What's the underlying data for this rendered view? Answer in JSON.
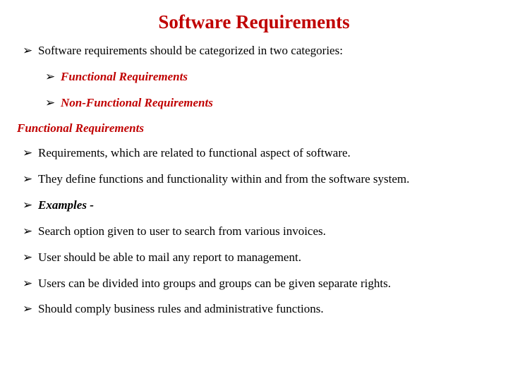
{
  "title": "Software Requirements",
  "intro": "Software requirements should be categorized in two categories:",
  "subs": {
    "a": "Functional Requirements",
    "b": "Non-Functional Requirements"
  },
  "section": "Functional Requirements",
  "bullets": {
    "b1": "Requirements, which are related to functional aspect of software.",
    "b2": "They define functions and functionality within and from the software system.",
    "b3": "Examples -",
    "b4": "Search option given to user to search from various invoices.",
    "b5": "User should be able to mail any report to management.",
    "b6": "Users can be divided into groups and groups can be given separate rights.",
    "b7": "Should comply business rules and administrative functions."
  }
}
